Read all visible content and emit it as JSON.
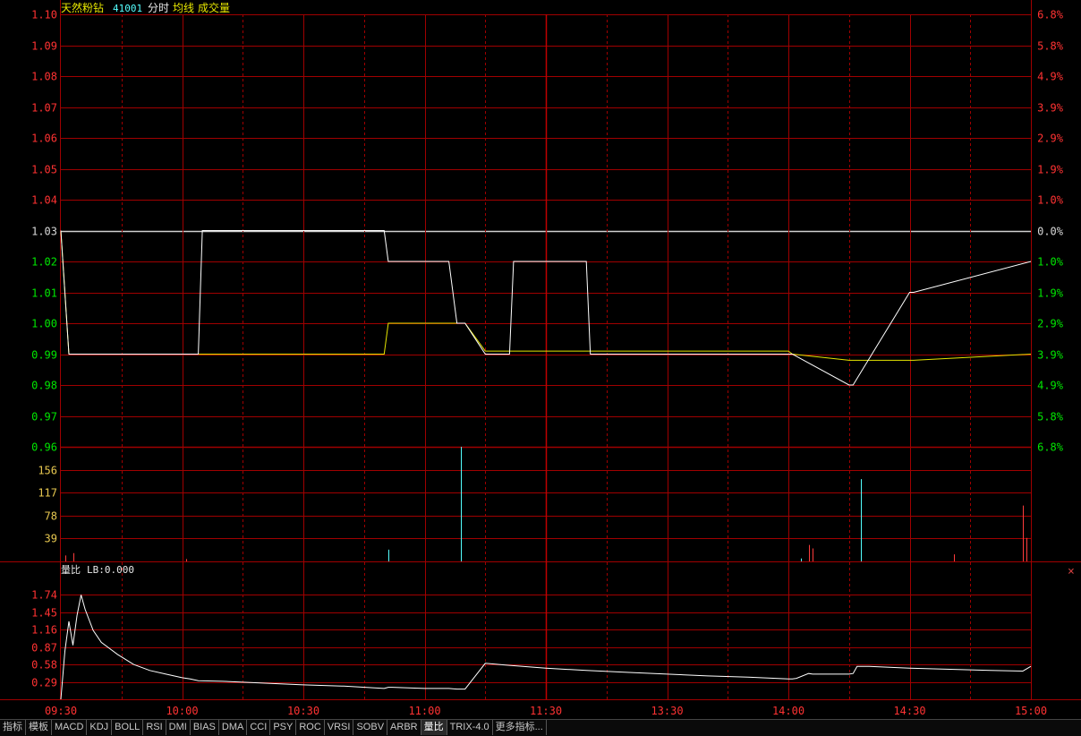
{
  "header": {
    "stock_name": "天然粉钻",
    "stock_code": "41001",
    "mode": "分时",
    "line_label": "均线",
    "volume_label": "成交量"
  },
  "colors": {
    "grid_red": "#a00000",
    "up_red": "#ff3232",
    "down_green": "#00e600",
    "flat_white": "#d8d8d8",
    "volume_tick_yellow": "#e8c850",
    "price_line": "#ffffff",
    "avg_line": "#e6e600",
    "vol_up": "#ff3c3c",
    "vol_down": "#54ffff"
  },
  "price_panel": {
    "prev_close": 1.03,
    "price_ticks": [
      "1.10",
      "1.09",
      "1.08",
      "1.07",
      "1.06",
      "1.05",
      "1.04",
      "1.03",
      "1.02",
      "1.01",
      "1.00",
      "0.99",
      "0.98",
      "0.97",
      "0.96"
    ],
    "pct_ticks": [
      "6.8%",
      "5.8%",
      "4.9%",
      "3.9%",
      "2.9%",
      "1.9%",
      "1.0%",
      "0.0%",
      "1.0%",
      "1.9%",
      "2.9%",
      "3.9%",
      "4.9%",
      "5.8%",
      "6.8%"
    ],
    "ylim": [
      0.96,
      1.1
    ]
  },
  "volume_panel": {
    "ticks": [
      "156",
      "117",
      "78",
      "39"
    ],
    "ylim": [
      0,
      195
    ]
  },
  "ratio_panel": {
    "title": "量比",
    "indicator_label": "LB:0.000",
    "ticks": [
      "1.74",
      "1.45",
      "1.16",
      "0.87",
      "0.58",
      "0.29"
    ],
    "ylim": [
      0,
      2.03
    ]
  },
  "time_axis": [
    "09:30",
    "10:00",
    "10:30",
    "11:00",
    "11:30",
    "13:30",
    "14:00",
    "14:30",
    "15:00"
  ],
  "chart_data": {
    "type": "line",
    "x_minutes": [
      0,
      1,
      2,
      10,
      30,
      34,
      35,
      36,
      80,
      81,
      95,
      96,
      98,
      100,
      105,
      106,
      111,
      112,
      130,
      131,
      180,
      181,
      195,
      196,
      210,
      211,
      240
    ],
    "series": [
      {
        "name": "price",
        "values": [
          1.03,
          1.01,
          0.99,
          0.99,
          0.99,
          0.99,
          1.03,
          1.03,
          1.03,
          1.02,
          1.02,
          1.02,
          1.0,
          1.0,
          0.99,
          0.99,
          0.99,
          1.02,
          1.02,
          0.99,
          0.99,
          0.99,
          0.98,
          0.98,
          1.01,
          1.01,
          1.02
        ]
      },
      {
        "name": "average",
        "values": [
          1.03,
          1.01,
          0.99,
          0.99,
          0.99,
          0.99,
          0.99,
          0.99,
          0.99,
          1.0,
          1.0,
          1.0,
          1.0,
          1.0,
          0.991,
          0.991,
          0.991,
          0.991,
          0.991,
          0.991,
          0.991,
          0.99,
          0.988,
          0.988,
          0.988,
          0.988,
          0.99
        ]
      }
    ],
    "volume": [
      {
        "minute": 1,
        "value": 10,
        "dir": "up"
      },
      {
        "minute": 3,
        "value": 14,
        "dir": "up"
      },
      {
        "minute": 31,
        "value": 4,
        "dir": "up"
      },
      {
        "minute": 81,
        "value": 20,
        "dir": "down"
      },
      {
        "minute": 99,
        "value": 195,
        "dir": "down"
      },
      {
        "minute": 183,
        "value": 5,
        "dir": "down"
      },
      {
        "minute": 185,
        "value": 28,
        "dir": "up"
      },
      {
        "minute": 186,
        "value": 22,
        "dir": "up"
      },
      {
        "minute": 198,
        "value": 140,
        "dir": "down"
      },
      {
        "minute": 221,
        "value": 12,
        "dir": "up"
      },
      {
        "minute": 238,
        "value": 95,
        "dir": "up"
      },
      {
        "minute": 239,
        "value": 40,
        "dir": "up"
      }
    ],
    "volume_ratio": {
      "x_minutes": [
        0,
        1,
        2,
        3,
        4,
        5,
        6,
        8,
        10,
        14,
        18,
        22,
        26,
        30,
        32,
        34,
        40,
        50,
        60,
        70,
        80,
        81,
        82,
        86,
        90,
        96,
        98,
        100,
        105,
        110,
        120,
        130,
        140,
        150,
        160,
        170,
        180,
        181,
        182,
        185,
        186,
        195,
        196,
        197,
        200,
        210,
        220,
        230,
        238,
        240
      ],
      "values": [
        0,
        0.8,
        1.3,
        0.9,
        1.4,
        1.74,
        1.5,
        1.15,
        0.95,
        0.75,
        0.58,
        0.48,
        0.42,
        0.36,
        0.34,
        0.31,
        0.3,
        0.27,
        0.24,
        0.22,
        0.18,
        0.2,
        0.2,
        0.19,
        0.18,
        0.18,
        0.17,
        0.17,
        0.6,
        0.57,
        0.52,
        0.48,
        0.45,
        0.42,
        0.39,
        0.37,
        0.34,
        0.34,
        0.35,
        0.43,
        0.42,
        0.42,
        0.43,
        0.55,
        0.55,
        0.52,
        0.5,
        0.48,
        0.47,
        0.55
      ]
    }
  },
  "tabs": [
    "指标",
    "模板",
    "MACD",
    "KDJ",
    "BOLL",
    "RSI",
    "DMI",
    "BIAS",
    "DMA",
    "CCI",
    "PSY",
    "ROC",
    "VRSI",
    "SOBV",
    "ARBR",
    "量比",
    "TRIX-4.0",
    "更多指标..."
  ],
  "active_tab": "量比",
  "close_symbol": "×"
}
